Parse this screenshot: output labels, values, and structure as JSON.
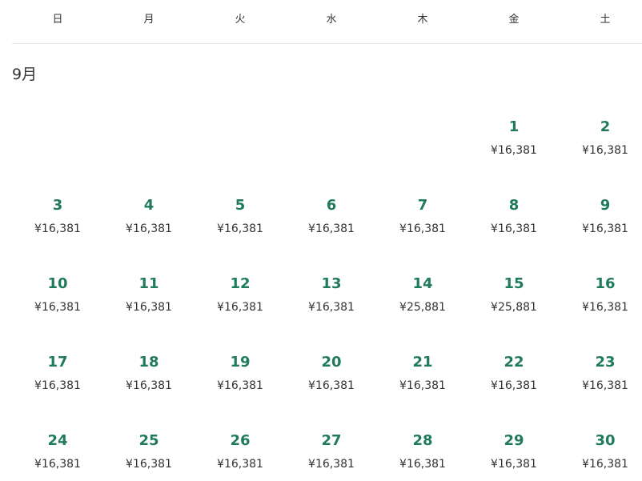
{
  "weekdays": [
    "日",
    "月",
    "火",
    "水",
    "木",
    "金",
    "土"
  ],
  "month_title": "9月",
  "leading_blanks": 5,
  "days": [
    {
      "day": "1",
      "price": "¥16,381"
    },
    {
      "day": "2",
      "price": "¥16,381"
    },
    {
      "day": "3",
      "price": "¥16,381"
    },
    {
      "day": "4",
      "price": "¥16,381"
    },
    {
      "day": "5",
      "price": "¥16,381"
    },
    {
      "day": "6",
      "price": "¥16,381"
    },
    {
      "day": "7",
      "price": "¥16,381"
    },
    {
      "day": "8",
      "price": "¥16,381"
    },
    {
      "day": "9",
      "price": "¥16,381"
    },
    {
      "day": "10",
      "price": "¥16,381"
    },
    {
      "day": "11",
      "price": "¥16,381"
    },
    {
      "day": "12",
      "price": "¥16,381"
    },
    {
      "day": "13",
      "price": "¥16,381"
    },
    {
      "day": "14",
      "price": "¥25,881"
    },
    {
      "day": "15",
      "price": "¥25,881"
    },
    {
      "day": "16",
      "price": "¥16,381"
    },
    {
      "day": "17",
      "price": "¥16,381"
    },
    {
      "day": "18",
      "price": "¥16,381"
    },
    {
      "day": "19",
      "price": "¥16,381"
    },
    {
      "day": "20",
      "price": "¥16,381"
    },
    {
      "day": "21",
      "price": "¥16,381"
    },
    {
      "day": "22",
      "price": "¥16,381"
    },
    {
      "day": "23",
      "price": "¥16,381"
    },
    {
      "day": "24",
      "price": "¥16,381"
    },
    {
      "day": "25",
      "price": "¥16,381"
    },
    {
      "day": "26",
      "price": "¥16,381"
    },
    {
      "day": "27",
      "price": "¥16,381"
    },
    {
      "day": "28",
      "price": "¥16,381"
    },
    {
      "day": "29",
      "price": "¥16,381"
    },
    {
      "day": "30",
      "price": "¥16,381"
    }
  ],
  "colors": {
    "day_number": "#1f7a5e",
    "text": "#333333",
    "divider": "#e6e6e6"
  }
}
